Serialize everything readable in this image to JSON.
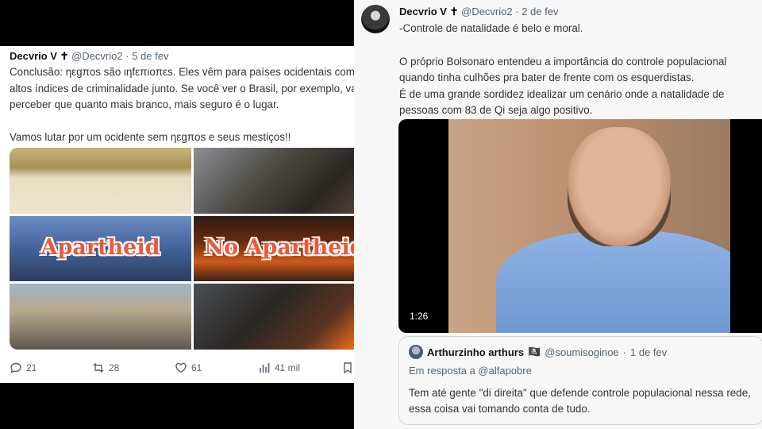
{
  "left_tweet": {
    "author_name": "Decvrio V ✝",
    "handle": "@Decvrio2",
    "separator": "·",
    "date": "5 de fev",
    "more": "•••",
    "paragraph1": "Conclusão: ηεgπos são ιηfεπιoπεs. Eles vêm para países ocidentais com altos índices de criminalidade junto. Se você ver o Brasil, por exemplo, vai perceber que quanto mais branco, mais seguro é o lugar.",
    "paragraph2": "Vamos lutar por um ocidente sem ηεgπos e seus mestiços!!",
    "image_labels": {
      "apartheid": "Apartheid",
      "no_apartheid": "No Apartheid"
    },
    "actions": {
      "replies": "21",
      "retweets": "28",
      "likes": "61",
      "views": "41 mil"
    }
  },
  "right_tweet": {
    "author_name": "Decvrio V ✝",
    "handle": "@Decvrio2",
    "separator": "·",
    "date": "2 de fev",
    "paragraph1": "-Controle de natalidade é belo e moral.",
    "paragraph2": "O próprio Bolsonaro entendeu a importância do controle populacional quando tinha culhões pra bater de frente com os esquerdistas.",
    "paragraph3": " É de uma grande sordidez idealizar um cenário onde a natalidade de pessoas com 83 de Qi seja algo positivo.",
    "video_duration": "1:26",
    "quoted": {
      "author_name": "Arthurzinho arthurs",
      "badge": "🏴‍☠️",
      "handle": "@soumisoginoe",
      "separator": "·",
      "date": "1 de fev",
      "reply_to": "Em resposta a @alfapobre",
      "text": "Tem até gente \"di direita\" que defende controle populacional nessa rede, essa coisa vai tomando conta de tudo."
    }
  }
}
